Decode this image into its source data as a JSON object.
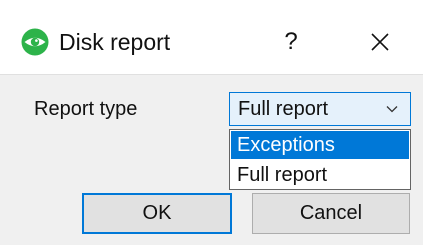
{
  "window": {
    "title": "Disk report",
    "help_label": "?"
  },
  "form": {
    "report_type_label": "Report type",
    "select": {
      "value": "Full report",
      "options": [
        "Exceptions",
        "Full report"
      ],
      "highlighted": "Exceptions"
    }
  },
  "buttons": {
    "ok_label": "OK",
    "cancel_label": "Cancel"
  },
  "colors": {
    "accent": "#0078d7",
    "icon_green": "#2db34a",
    "select_bg": "#e5f1fb",
    "button_bg": "#e1e1e1"
  },
  "icons": {
    "app": "eye-icon",
    "close": "close-icon",
    "dropdown": "chevron-down-icon"
  }
}
